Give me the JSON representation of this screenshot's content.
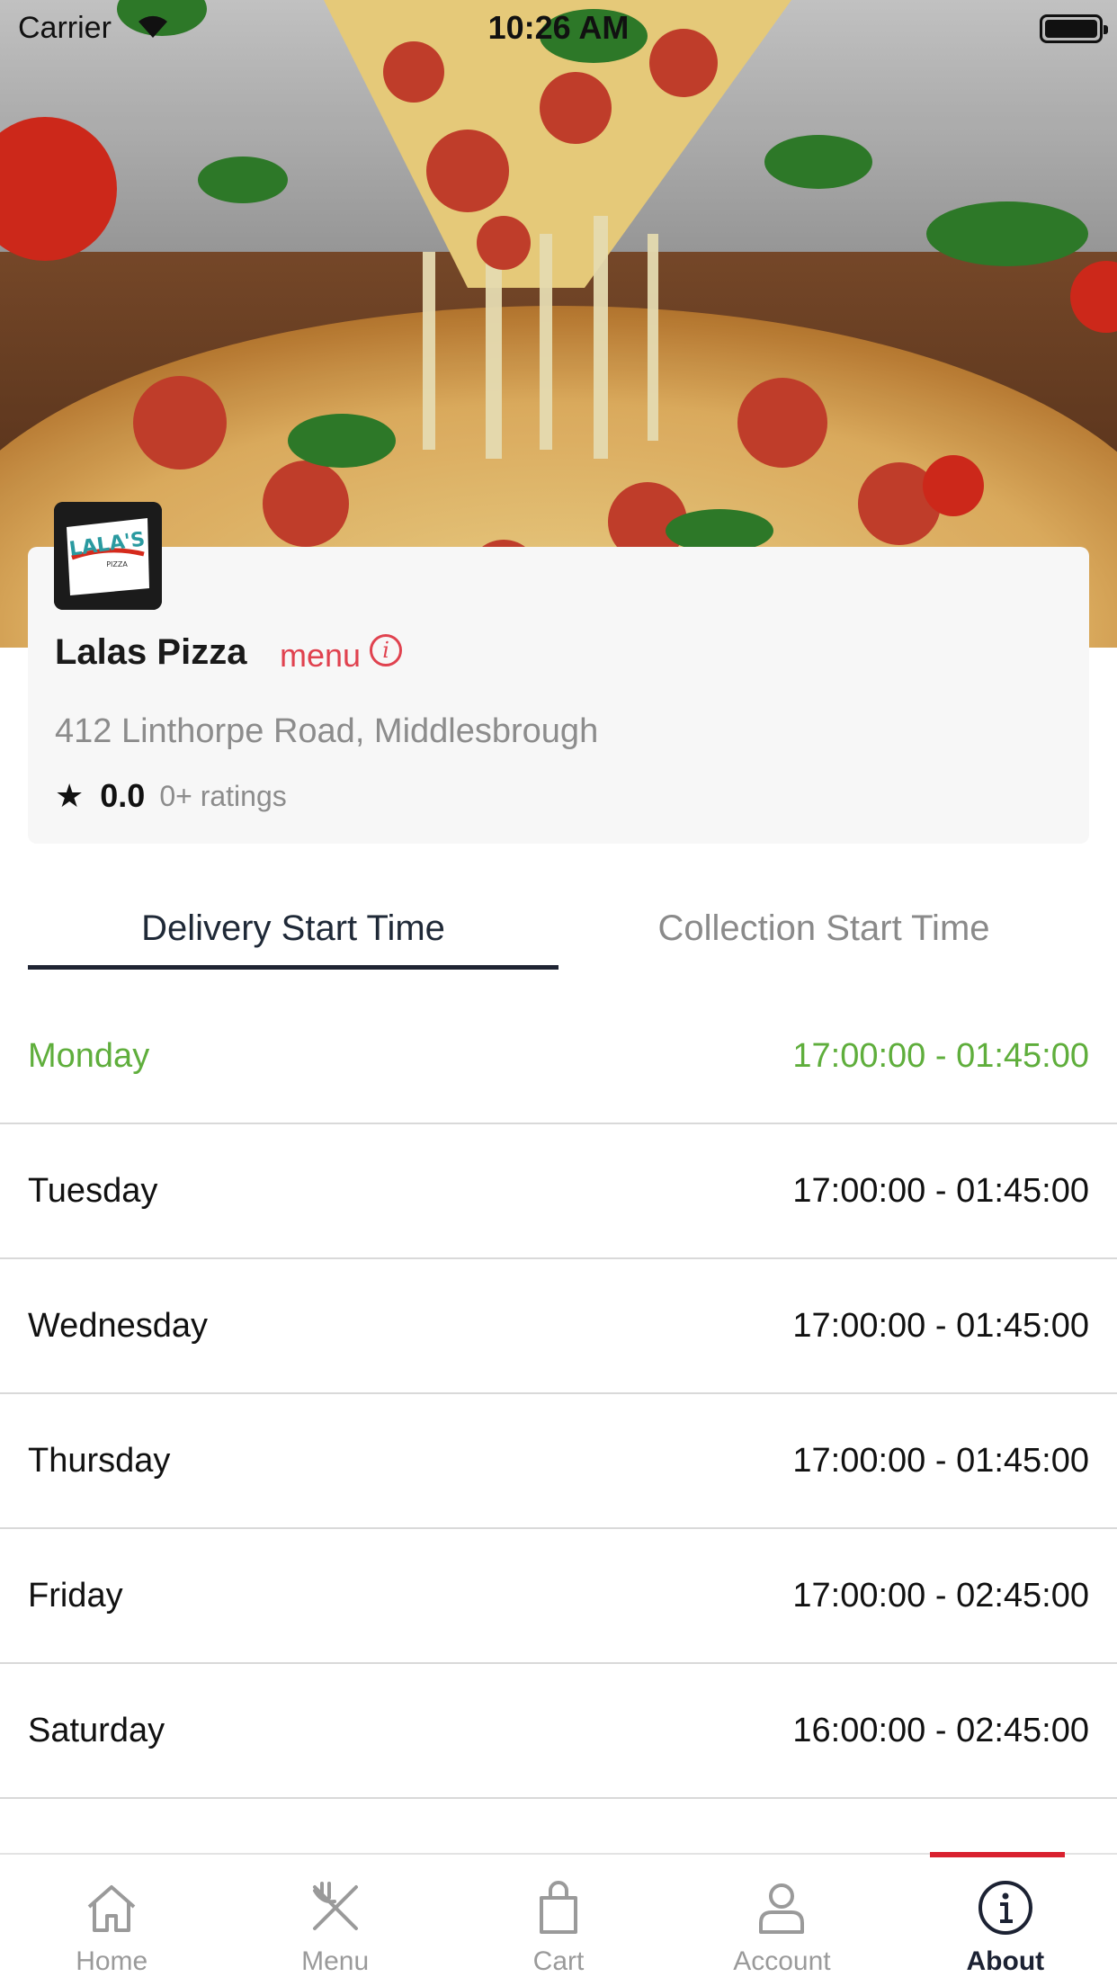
{
  "status_bar": {
    "carrier": "Carrier",
    "time": "10:26 AM"
  },
  "store": {
    "name": "Lalas Pizza",
    "menu_link": "menu",
    "address": "412 Linthorpe Road, Middlesbrough",
    "rating_value": "0.0",
    "rating_count": "0+ ratings",
    "logo_text": "LALA'S"
  },
  "tabs": {
    "delivery": "Delivery Start Time",
    "collection": "Collection Start Time",
    "selected": "delivery"
  },
  "schedule": [
    {
      "day": "Monday",
      "hours": "17:00:00 - 01:45:00"
    },
    {
      "day": "Tuesday",
      "hours": "17:00:00 - 01:45:00"
    },
    {
      "day": "Wednesday",
      "hours": "17:00:00 - 01:45:00"
    },
    {
      "day": "Thursday",
      "hours": "17:00:00 - 01:45:00"
    },
    {
      "day": "Friday",
      "hours": "17:00:00 - 02:45:00"
    },
    {
      "day": "Saturday",
      "hours": "16:00:00 - 02:45:00"
    }
  ],
  "bottom_nav": [
    {
      "label": "Home",
      "icon": "home-icon"
    },
    {
      "label": "Menu",
      "icon": "fork-knife-icon"
    },
    {
      "label": "Cart",
      "icon": "shopping-bag-icon"
    },
    {
      "label": "Account",
      "icon": "user-icon"
    },
    {
      "label": "About",
      "icon": "info-icon",
      "active": true
    }
  ],
  "colors": {
    "accent_red": "#e0424f",
    "today_green": "#5fae3c",
    "tab_indicator": "#1f2433",
    "active_nav_bar": "#d9212f"
  }
}
